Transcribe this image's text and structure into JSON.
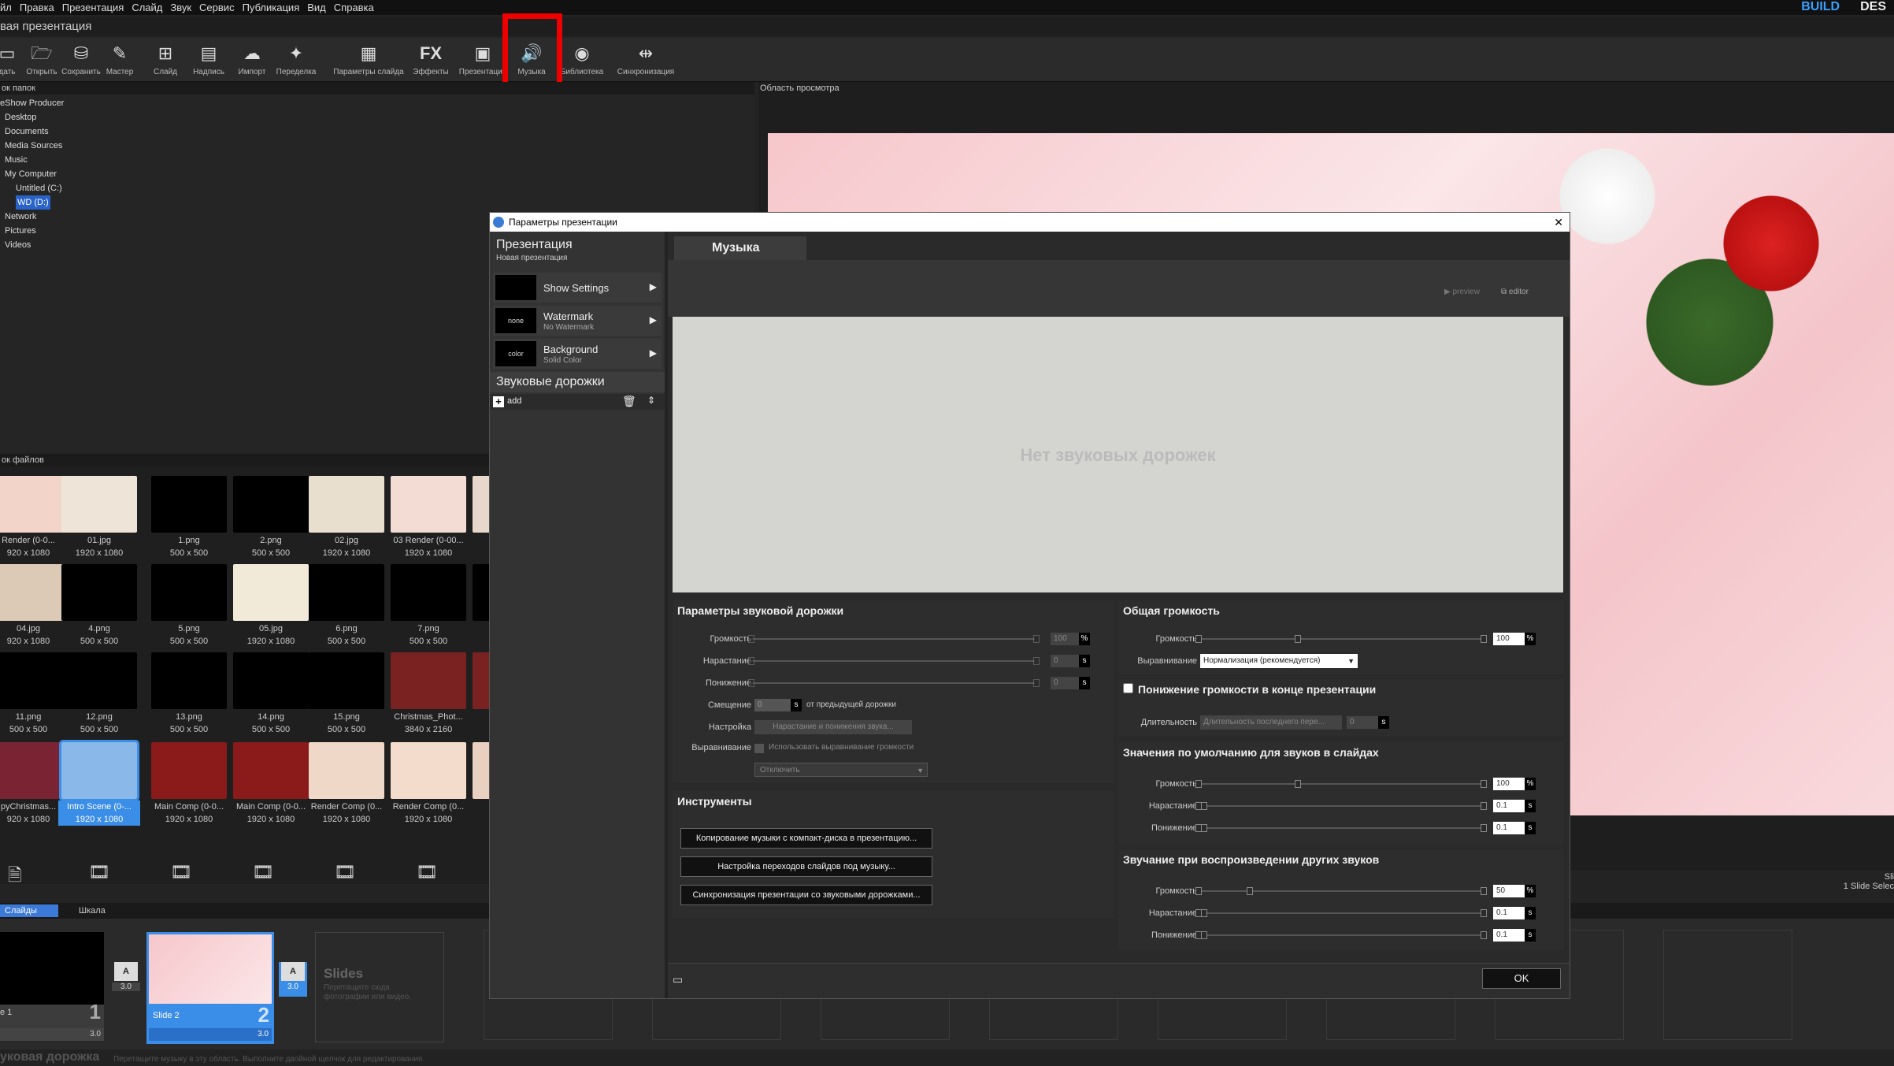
{
  "menu": {
    "items": [
      "йл",
      "Правка",
      "Презентация",
      "Слайд",
      "Звук",
      "Сервис",
      "Публикация",
      "Вид",
      "Справка"
    ],
    "tab_build": "BUILD",
    "tab_design": "DES"
  },
  "window": {
    "title": "вая презентация"
  },
  "toolbar": {
    "items": [
      "дать",
      "Открыть",
      "Сохранить",
      "Мастер",
      "Слайд",
      "Надпись",
      "Импорт",
      "Переделка",
      "Параметры слайда",
      "Эффекты",
      "Презентация",
      "Музыка",
      "Библиотека",
      "Синхронизация"
    ],
    "fx": "FX"
  },
  "folders": {
    "header": "ок папок",
    "items": [
      "eShow Producer",
      "Desktop",
      "Documents",
      "Media Sources",
      "Music",
      "My Computer",
      "Untitled (C:)",
      "WD (D:)",
      "Network",
      "Pictures",
      "Videos"
    ]
  },
  "preview": {
    "header": "Область просмотра"
  },
  "files": {
    "header": "ок файлов",
    "rows": [
      [
        {
          "name": "Render (0-0...",
          "size": "920 x 1080"
        },
        {
          "name": "01.jpg",
          "size": "1920 x 1080"
        },
        {
          "name": "1.png",
          "size": "500 x 500"
        },
        {
          "name": "2.png",
          "size": "500 x 500"
        },
        {
          "name": "02.jpg",
          "size": "1920 x 1080"
        },
        {
          "name": "03 Render (0-00...",
          "size": "1920 x 1080"
        },
        {
          "name": "03 R",
          "size": "1"
        }
      ],
      [
        {
          "name": "04.jpg",
          "size": "920 x 1080"
        },
        {
          "name": "4.png",
          "size": "500 x 500"
        },
        {
          "name": "5.png",
          "size": "500 x 500"
        },
        {
          "name": "05.jpg",
          "size": "1920 x 1080"
        },
        {
          "name": "6.png",
          "size": "500 x 500"
        },
        {
          "name": "7.png",
          "size": "500 x 500"
        },
        {
          "name": "",
          "size": ""
        }
      ],
      [
        {
          "name": "11.png",
          "size": "500 x 500"
        },
        {
          "name": "12.png",
          "size": "500 x 500"
        },
        {
          "name": "13.png",
          "size": "500 x 500"
        },
        {
          "name": "14.png",
          "size": "500 x 500"
        },
        {
          "name": "15.png",
          "size": "500 x 500"
        },
        {
          "name": "Christmas_Phot...",
          "size": "3840 x 2160"
        },
        {
          "name": "Chr",
          "size": "1"
        }
      ],
      [
        {
          "name": "pyChristmas...",
          "size": "920 x 1080"
        },
        {
          "name": "Intro Scene (0-...",
          "size": "1920 x 1080"
        },
        {
          "name": "Main Comp (0-0...",
          "size": "1920 x 1080"
        },
        {
          "name": "Main Comp (0-0...",
          "size": "1920 x 1080"
        },
        {
          "name": "Render Comp (0...",
          "size": "1920 x 1080"
        },
        {
          "name": "Render Comp (0...",
          "size": "1920 x 1080"
        },
        {
          "name": "Ren",
          "size": "1"
        }
      ]
    ]
  },
  "slides_tabs": {
    "slides": "Слайды",
    "timeline": "Шкала"
  },
  "slides": {
    "s1_label": "e 1",
    "s1_num": "1",
    "s1_dur": "3.0",
    "s2_label": "Slide 2",
    "s2_num": "2",
    "s2_dur": "3.0",
    "t1": "3.0",
    "t2": "3.0",
    "placeholder_title": "Slides",
    "placeholder_sub1": "Перетащите сюда",
    "placeholder_sub2": "фотографии или видео.",
    "right_info1": "Sli",
    "right_info2": "1 Slide Selec"
  },
  "soundtrack": {
    "title": "уковая дорожка",
    "hint": "Перетащите музыку в эту область. Выполните двойной щелчок для редактирования."
  },
  "dialog": {
    "title": "Параметры презентации",
    "close": "✕",
    "side": {
      "header": "Презентация",
      "subheader": "Новая презентация",
      "items": [
        {
          "swatch": "",
          "t1": "Show Settings",
          "t2": ""
        },
        {
          "swatch": "none",
          "t1": "Watermark",
          "t2": "No Watermark"
        },
        {
          "swatch": "color",
          "t1": "Background",
          "t2": "Solid Color"
        }
      ],
      "tracks_header": "Звуковые дорожки",
      "add": "add"
    },
    "tab": "Музыка",
    "preview": "preview",
    "editor": "editor",
    "empty": "Нет звуковых дорожек",
    "track_params": {
      "header": "Параметры звуковой дорожки",
      "volume": "Громкость",
      "volume_val": "100",
      "fadein": "Нарастание",
      "fadein_val": "0",
      "fadeout": "Понижение",
      "fadeout_val": "0",
      "offset": "Смещение",
      "offset_val": "0",
      "offset_suffix": "от предыдущей дорожки",
      "setting": "Настройка",
      "setting_btn": "Нарастание и понижения звука...",
      "align": "Выравнивание",
      "align_check": "Использовать выравнивание громкости",
      "align_select": "Отключить",
      "pct": "%",
      "sec": "s"
    },
    "tools": {
      "header": "Инструменты",
      "b1": "Копирование музыки с компакт-диска в презентацию...",
      "b2": "Настройка переходов слайдов под музыку...",
      "b3": "Синхронизация презентации со звуковыми дорожками..."
    },
    "overall": {
      "header": "Общая громкость",
      "volume": "Громкость",
      "volume_val": "100",
      "align": "Выравнивание",
      "align_val": "Нормализация (рекомендуется)"
    },
    "fadeend": {
      "header": "Понижение громкости в конце презентации",
      "duration": "Длительность",
      "duration_val": "Длительность последнего пере...",
      "duration_num": "0"
    },
    "defaults": {
      "header": "Значения по умолчанию для звуков в слайдах",
      "volume": "Громкость",
      "volume_val": "100",
      "fadein": "Нарастание",
      "fadein_val": "0.1",
      "fadeout": "Понижение",
      "fadeout_val": "0.1"
    },
    "other": {
      "header": "Звучание при воспроизведении других звуков",
      "volume": "Громкость",
      "volume_val": "50",
      "fadein": "Нарастание",
      "fadein_val": "0.1",
      "fadeout": "Понижение",
      "fadeout_val": "0.1"
    },
    "ok": "OK"
  }
}
